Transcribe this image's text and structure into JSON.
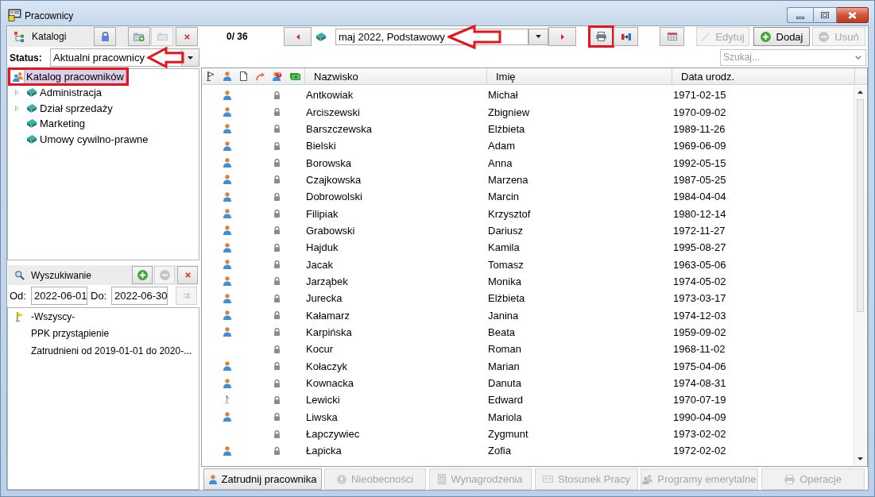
{
  "window": {
    "title": "Pracownicy"
  },
  "catalogs": {
    "title": "Katalogi",
    "buttons": [
      {
        "kind": "lock",
        "disabled": false
      },
      {
        "kind": "folder_add",
        "disabled": false
      },
      {
        "kind": "folder",
        "disabled": true
      },
      {
        "kind": "close",
        "disabled": false
      }
    ],
    "status": {
      "label": "Status:",
      "value": "Aktualni pracownicy",
      "callout_arrow": true
    },
    "tree": [
      {
        "label": "Katalog pracowników",
        "selected": true,
        "callout_frame": true,
        "children": [
          {
            "label": "Administracja",
            "selected": false,
            "expandable": true
          },
          {
            "label": "Dział sprzedaży",
            "selected": false,
            "expandable": true
          },
          {
            "label": "Marketing",
            "selected": false,
            "expandable": false
          },
          {
            "label": "Umowy cywilno-prawne",
            "selected": false,
            "expandable": false
          }
        ]
      }
    ]
  },
  "search_panel": {
    "title": "Wyszukiwanie",
    "buttons": [
      {
        "kind": "add",
        "disabled": false
      },
      {
        "kind": "remove",
        "disabled": true
      },
      {
        "kind": "close",
        "disabled": false
      }
    ],
    "from": {
      "label": "Od:",
      "value": "2022-06-01"
    },
    "to": {
      "label": "Do:",
      "value": "2022-06-30"
    },
    "apply_button": {
      "disabled": true
    },
    "filters": [
      {
        "label": "-Wszyscy-",
        "selected": false,
        "flagged": true
      },
      {
        "label": "PPK przystąpienie",
        "selected": false,
        "flagged": false
      },
      {
        "label": "Zatrudnieni od 2019-01-01 do 2020-...",
        "selected": false,
        "flagged": false
      }
    ]
  },
  "toolbar": {
    "counter": "0/ 36",
    "period": {
      "value": "maj 2022, Podstawowy",
      "callout_arrow": true
    },
    "tools": [
      {
        "kind": "print",
        "disabled": false,
        "callout_frame": true
      },
      {
        "kind": "export",
        "disabled": false,
        "callout_frame": false
      },
      {
        "kind": "columns",
        "disabled": false,
        "callout_frame": false
      }
    ],
    "actions": [
      {
        "label": "Edytuj",
        "kind": "edit",
        "disabled": true
      },
      {
        "label": "Dodaj",
        "kind": "add",
        "disabled": false
      },
      {
        "label": "Usuń",
        "kind": "remove",
        "disabled": true
      }
    ]
  },
  "search": {
    "placeholder": "Szukaj..."
  },
  "table": {
    "icon_columns": [
      {
        "kind": "flag"
      },
      {
        "kind": "person"
      },
      {
        "kind": "document"
      },
      {
        "kind": "arrow"
      },
      {
        "kind": "person_question"
      },
      {
        "kind": "money"
      }
    ],
    "columns": [
      "Nazwisko",
      "Imię",
      "Data urodz."
    ],
    "rows": [
      {
        "kind": "person",
        "locked": true,
        "cells": [
          "Antkowiak",
          "Michał",
          "1971-02-15"
        ]
      },
      {
        "kind": "person",
        "locked": true,
        "cells": [
          "Arciszewski",
          "Zbigniew",
          "1970-09-02"
        ]
      },
      {
        "kind": "person",
        "locked": true,
        "cells": [
          "Barszczewska",
          "Elżbieta",
          "1989-11-26"
        ]
      },
      {
        "kind": "person",
        "locked": true,
        "cells": [
          "Bielski",
          "Adam",
          "1969-06-09"
        ]
      },
      {
        "kind": "person",
        "locked": true,
        "cells": [
          "Borowska",
          "Anna",
          "1992-05-15"
        ]
      },
      {
        "kind": "person",
        "locked": true,
        "cells": [
          "Czajkowska",
          "Marzena",
          "1987-05-25"
        ]
      },
      {
        "kind": "person",
        "locked": true,
        "cells": [
          "Dobrowolski",
          "Marcin",
          "1984-04-04"
        ]
      },
      {
        "kind": "person",
        "locked": true,
        "cells": [
          "Filipiak",
          "Krzysztof",
          "1980-12-14"
        ]
      },
      {
        "kind": "person",
        "locked": true,
        "cells": [
          "Grabowski",
          "Dariusz",
          "1972-11-27"
        ]
      },
      {
        "kind": "person",
        "locked": true,
        "cells": [
          "Hajduk",
          "Kamila",
          "1995-08-27"
        ]
      },
      {
        "kind": "person",
        "locked": true,
        "cells": [
          "Jacak",
          "Tomasz",
          "1963-05-06"
        ]
      },
      {
        "kind": "person",
        "locked": true,
        "cells": [
          "Jarząbek",
          "Monika",
          "1974-05-02"
        ]
      },
      {
        "kind": "person",
        "locked": true,
        "cells": [
          "Jurecka",
          "Elżbieta",
          "1973-03-17"
        ]
      },
      {
        "kind": "person",
        "locked": true,
        "cells": [
          "Kałamarz",
          "Janina",
          "1974-12-03"
        ]
      },
      {
        "kind": "person",
        "locked": true,
        "cells": [
          "Karpińska",
          "Beata",
          "1959-09-02"
        ]
      },
      {
        "kind": "blank",
        "locked": true,
        "cells": [
          "Kocur",
          "Roman",
          "1968-11-02"
        ]
      },
      {
        "kind": "person",
        "locked": true,
        "cells": [
          "Kołaczyk",
          "Marian",
          "1975-04-06"
        ]
      },
      {
        "kind": "person",
        "locked": true,
        "cells": [
          "Kownacka",
          "Danuta",
          "1974-08-31"
        ]
      },
      {
        "kind": "figure",
        "locked": true,
        "cells": [
          "Lewicki",
          "Edward",
          "1970-07-19"
        ]
      },
      {
        "kind": "person",
        "locked": true,
        "cells": [
          "Liwska",
          "Mariola",
          "1990-04-09"
        ]
      },
      {
        "kind": "blank",
        "locked": true,
        "cells": [
          "Łapczywiec",
          "Zygmunt",
          "1973-02-02"
        ]
      },
      {
        "kind": "person",
        "locked": true,
        "cells": [
          "Łapicka",
          "Zofia",
          "1972-02-02"
        ]
      }
    ]
  },
  "bottom_buttons": [
    {
      "label": "Zatrudnij pracownika",
      "kind": "person",
      "disabled": false
    },
    {
      "label": "Nieobecności",
      "kind": "alert",
      "disabled": true
    },
    {
      "label": "Wynagrodzenia",
      "kind": "calculator",
      "disabled": true
    },
    {
      "label": "Stosunek Pracy",
      "kind": "card",
      "disabled": true
    },
    {
      "label": "Programy emerytalne",
      "kind": "people",
      "disabled": true
    },
    {
      "label": "Operacje",
      "kind": "printer",
      "disabled": true
    }
  ]
}
